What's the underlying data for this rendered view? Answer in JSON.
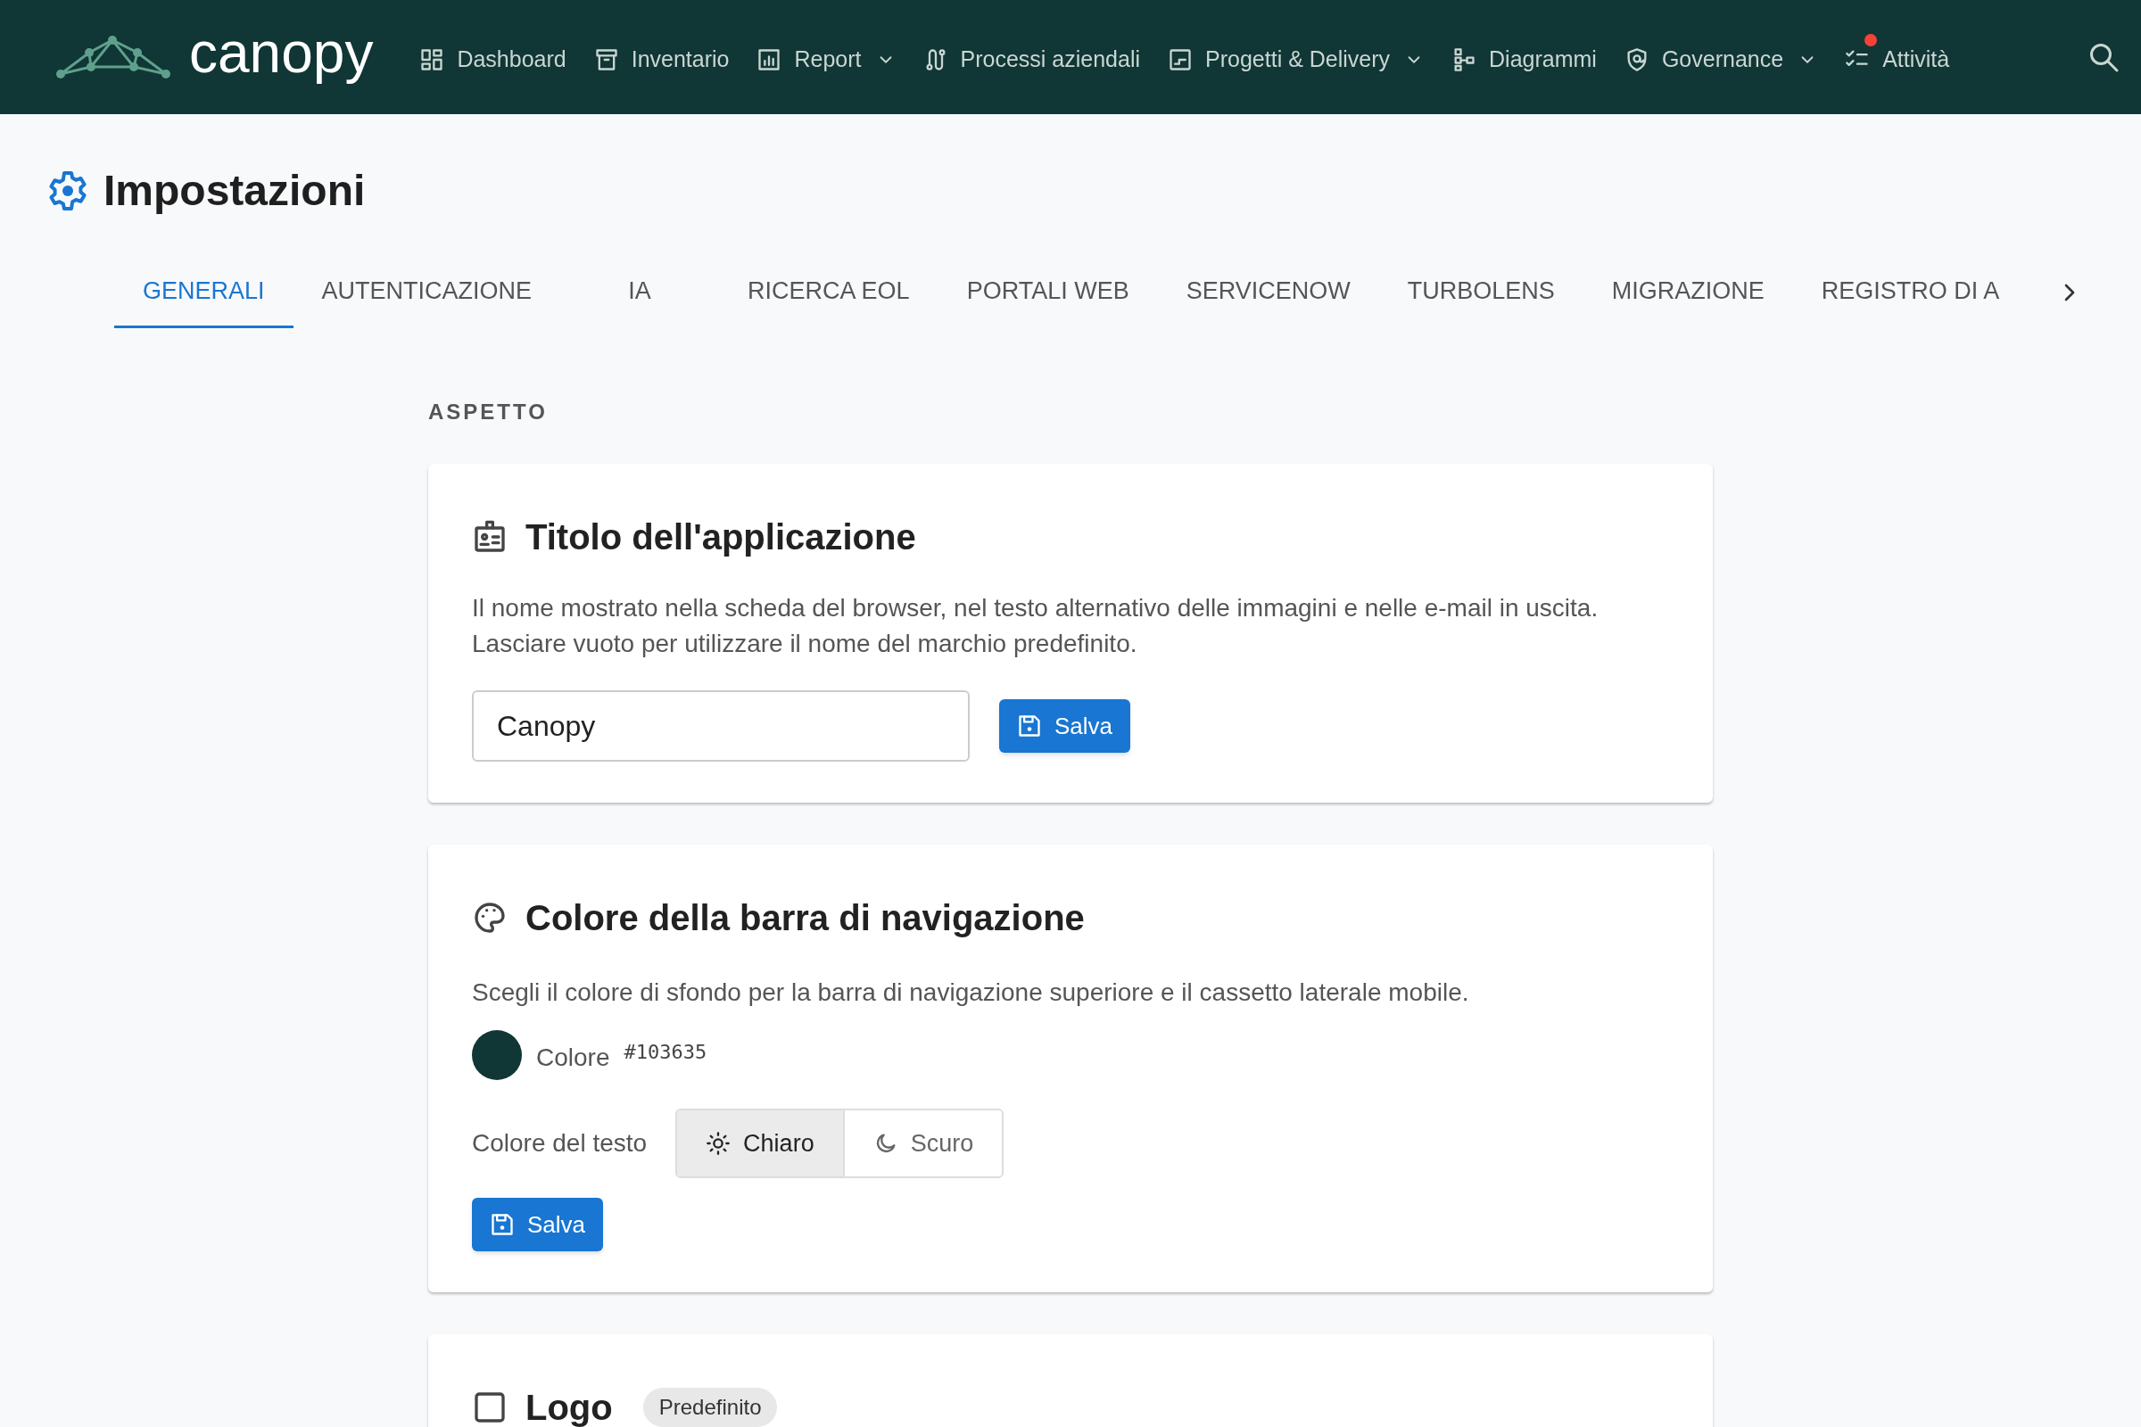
{
  "navbar": {
    "brand": "canopy",
    "items": [
      {
        "label": "Dashboard",
        "dropdown": false,
        "notification": false
      },
      {
        "label": "Inventario",
        "dropdown": false,
        "notification": false
      },
      {
        "label": "Report",
        "dropdown": true,
        "notification": false
      },
      {
        "label": "Processi aziendali",
        "dropdown": false,
        "notification": false
      },
      {
        "label": "Progetti & Delivery",
        "dropdown": true,
        "notification": false
      },
      {
        "label": "Diagrammi",
        "dropdown": false,
        "notification": false
      },
      {
        "label": "Governance",
        "dropdown": true,
        "notification": false
      },
      {
        "label": "Attività",
        "dropdown": false,
        "notification": true
      }
    ]
  },
  "page": {
    "title": "Impostazioni"
  },
  "tabs": [
    {
      "label": "GENERALI",
      "selected": true
    },
    {
      "label": "AUTENTICAZIONE",
      "selected": false
    },
    {
      "label": "IA",
      "selected": false
    },
    {
      "label": "RICERCA EOL",
      "selected": false
    },
    {
      "label": "PORTALI WEB",
      "selected": false
    },
    {
      "label": "SERVICENOW",
      "selected": false
    },
    {
      "label": "TURBOLENS",
      "selected": false
    },
    {
      "label": "MIGRAZIONE",
      "selected": false
    },
    {
      "label": "REGISTRO DI A",
      "selected": false
    }
  ],
  "section": {
    "label": "ASPETTO"
  },
  "cards": [
    {
      "kind": "title",
      "title": "Titolo dell'applicazione",
      "description": "Il nome mostrato nella scheda del browser, nel testo alternativo delle immagini e nelle e-mail in uscita. Lasciare vuoto per utilizzare il nome del marchio predefinito.",
      "value": "Canopy",
      "button": "Salva"
    },
    {
      "kind": "navcolor",
      "title": "Colore della barra di navigazione",
      "description": "Scegli il colore di sfondo per la barra di navigazione superiore e il cassetto laterale mobile.",
      "color_label": "Colore",
      "color": "#103635",
      "color_text": "#103635",
      "text_color_label": "Colore del testo",
      "options": [
        {
          "label": "Chiaro",
          "selected": true
        },
        {
          "label": "Scuro",
          "selected": false
        }
      ],
      "button": "Salva"
    },
    {
      "kind": "logo",
      "title": "Logo",
      "badge": "Predefinito"
    }
  ]
}
